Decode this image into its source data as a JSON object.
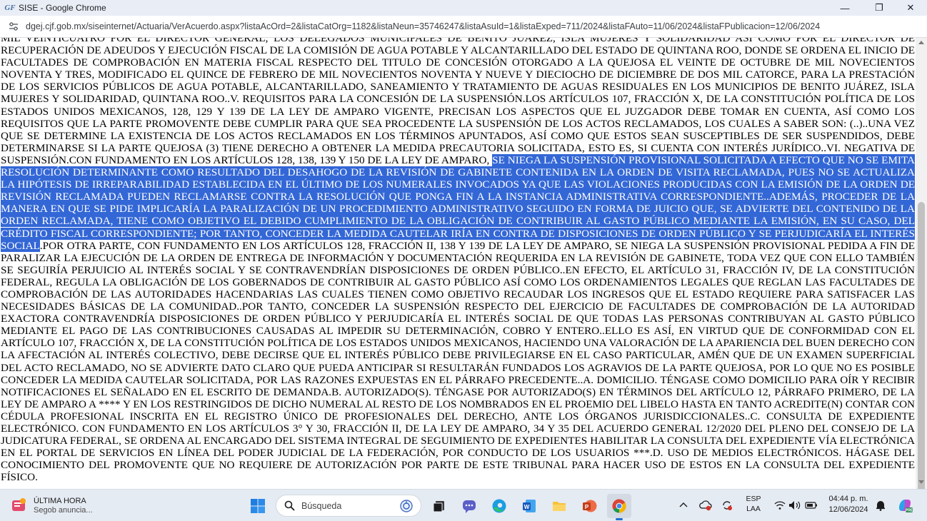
{
  "window": {
    "app_icon_glyph": "GF",
    "title": "SISE - Google Chrome",
    "minimize_glyph": "—",
    "maximize_glyph": "❐",
    "close_glyph": "✕"
  },
  "address_bar": {
    "url": "dgej.cjf.gob.mx/siseinternet/Actuaria/VerAcuerdo.aspx?listaAcOrd=2&listaCatOrg=1182&listaNeun=35746247&listaAsuId=1&listaExped=711/2024&listaFAuto=11/06/2024&listaFPublicacion=12/06/2024"
  },
  "document": {
    "text_before_selection": "MIL VEINTICUATRO POR EL DIRECTOR GENERAL, LOS DELEGADOS MUNICIPALES DE BENITO JUÁREZ, ISLA MUJERES Y SOLIDARIDAD ASÍ COMO POR EL DIRECTOR DE RECUPERACIÓN DE ADEUDOS Y EJECUCIÓN FISCAL DE LA COMISIÓN DE AGUA POTABLE Y ALCANTARILLADO DEL ESTADO DE QUINTANA ROO, DONDE SE ORDENA EL INICIO DE FACULTADES DE COMPROBACIÓN EN MATERIA FISCAL RESPECTO DEL TITULO DE CONCESIÓN OTORGADO A LA QUEJOSA EL VEINTE DE OCTUBRE DE MIL NOVECIENTOS NOVENTA Y TRES, MODIFICADO EL QUINCE DE FEBRERO DE MIL NOVECIENTOS NOVENTA Y NUEVE Y DIECIOCHO DE DICIEMBRE DE DOS MIL CATORCE, PARA LA PRESTACIÓN DE LOS SERVICIOS PÚBLICOS DE AGUA POTABLE, ALCANTARILLADO, SANEAMIENTO Y TRATAMIENTO DE AGUAS RESIDUALES EN LOS MUNICIPIOS DE BENITO JUÁREZ, ISLA MUJERES Y SOLIDARIDAD, QUINTANA ROO..V. REQUISITOS PARA LA CONCESIÓN DE LA SUSPENSIÓN.LOS ARTÍCULOS 107, FRACCIÓN X, DE LA CONSTITUCIÓN POLÍTICA DE LOS ESTADOS UNIDOS MEXICANOS, 128, 129 Y 139 DE LA LEY DE AMPARO VIGENTE, PRECISAN LOS ASPECTOS QUE EL JUZGADOR DEBE TOMAR EN CUENTA, ASÍ COMO LOS REQUISITOS QUE LA PARTE PROMOVENTE DEBE CUMPLIR PARA QUE SEA PROCEDENTE LA SUSPENSIÓN DE LOS ACTOS RECLAMADOS, LOS CUALES A SABER SON: (..)..UNA VEZ QUE SE DETERMINE LA EXISTENCIA DE LOS ACTOS RECLAMADOS EN LOS TÉRMINOS APUNTADOS, ASÍ COMO QUE ESTOS SEAN SUSCEPTIBLES DE SER SUSPENDIDOS, DEBE DETERMINARSE SI LA PARTE QUEJOSA (3) TIENE DERECHO A OBTENER LA MEDIDA PRECAUTORIA SOLICITADA, ESTO ES, SI CUENTA CON INTERÉS JURÍDICO..VI. NEGATIVA DE SUSPENSIÓN.CON FUNDAMENTO EN LOS ARTÍCULOS 128, 138, 139 Y 150 DE LA LEY DE AMPARO, ",
    "selected_text": "SE NIEGA LA SUSPENSIÓN PROVISIONAL SOLICITADA A EFECTO QUE NO SE EMITA RESOLUCIÓN DETERMINANTE COMO RESULTADO DEL DESAHOGO DE LA REVISIÓN DE GABINETE CONTENIDA EN LA ORDEN DE VISITA RECLAMADA, PUES NO SE ACTUALIZA LA HIPÓTESIS DE IRREPARABILIDAD ESTABLECIDA EN EL ÚLTIMO DE LOS NUMERALES INVOCADOS YA QUE LAS VIOLACIONES PRODUCIDAS CON LA EMISIÓN DE LA ORDEN DE REVISIÓN RECLAMADA PUEDEN RECLAMARSE CONTRA LA RESOLUCIÓN QUE PONGA FIN A LA INSTANCIA ADMINISTRATIVA CORRESPONDIENTE..ADEMÁS, PROCEDER DE LA MANERA EN QUE SE PIDE IMPLICARÍA LA PARALIZACIÓN DE UN PROCEDIMIENTO ADMINISTRATIVO SEGUIDO EN FORMA DE JUICIO QUE, SE ADVIERTE DEL CONTENIDO DE LA ORDEN RECLAMADA, TIENE COMO OBJETIVO EL DEBIDO CUMPLIMIENTO DE LA OBLIGACIÓN DE CONTRIBUIR AL GASTO PÚBLICO MEDIANTE LA EMISIÓN, EN SU CASO, DEL CRÉDITO FISCAL CORRESPONDIENTE; POR TANTO, CONCEDER LA MEDIDA CAUTELAR IRÍA EN CONTRA DE DISPOSICIONES DE ORDEN PÚBLICO Y SE PERJUDICARÍA EL INTERÉS SOCIAL",
    "text_after_selection": ".POR OTRA PARTE, CON FUNDAMENTO EN LOS ARTÍCULOS 128, FRACCIÓN II, 138 Y 139 DE LA LEY DE AMPARO, SE NIEGA LA SUSPENSIÓN PROVISIONAL PEDIDA A FIN DE PARALIZAR LA EJECUCIÓN DE LA ORDEN DE ENTREGA DE INFORMACIÓN Y DOCUMENTACIÓN REQUERIDA EN LA REVISIÓN DE GABINETE, TODA VEZ QUE CON ELLO TAMBIÉN SE SEGUIRÍA PERJUICIO AL INTERÉS SOCIAL Y SE CONTRAVENDRÍAN DISPOSICIONES DE ORDEN PÚBLICO..EN EFECTO, EL ARTÍCULO 31, FRACCIÓN IV, DE LA CONSTITUCIÓN FEDERAL, REGULA LA OBLIGACIÓN DE LOS GOBERNADOS DE CONTRIBUIR AL GASTO PÚBLICO ASÍ COMO LOS ORDENAMIENTOS LEGALES QUE REGLAN LAS FACULTADES DE COMPROBACIÓN DE LAS AUTORIDADES HACENDARIAS LAS CUALES TIENEN COMO OBJETIVO RECAUDAR LOS INGRESOS QUE EL ESTADO REQUIERE PARA SATISFACER LAS NECESIDADES BÁSICAS DE LA COMUNIDAD..POR TANTO, CONCEDER LA SUSPENSIÓN RESPECTO DEL EJERCICIO DE FACULTADES DE COMPROBACIÓN DE LA AUTORIDAD EXACTORA CONTRAVENDRÍA DISPOSICIONES DE ORDEN PÚBLICO Y PERJUDICARÍA EL INTERÉS SOCIAL DE QUE TODAS LAS PERSONAS CONTRIBUYAN AL GASTO PÚBLICO MEDIANTE EL PAGO DE LAS CONTRIBUCIONES CAUSADAS AL IMPEDIR SU DETERMINACIÓN, COBRO Y ENTERO..ELLO ES ASÍ, EN VIRTUD QUE DE CONFORMIDAD CON EL ARTÍCULO 107, FRACCIÓN X, DE LA CONSTITUCIÓN POLÍTICA DE LOS ESTADOS UNIDOS MEXICANOS, HACIENDO UNA VALORACIÓN DE LA APARIENCIA DEL BUEN DERECHO CON LA AFECTACIÓN AL INTERÉS COLECTIVO, DEBE DECIRSE QUE EL INTERÉS PÚBLICO DEBE PRIVILEGIARSE EN EL CASO PARTICULAR, AMÉN QUE DE UN EXAMEN SUPERFICIAL DEL ACTO RECLAMADO, NO SE ADVIERTE DATO CLARO QUE PUEDA ANTICIPAR SI RESULTARÁN FUNDADOS LOS AGRAVIOS DE LA PARTE QUEJOSA, POR LO QUE NO ES POSIBLE CONCEDER LA MEDIDA CAUTELAR SOLICITADA, POR LAS RAZONES EXPUESTAS EN EL PÁRRAFO PRECEDENTE..A. DOMICILIO. TÉNGASE COMO DOMICILIO PARA OÍR Y RECIBIR NOTIFICACIONES EL SEÑALADO EN EL ESCRITO DE DEMANDA.B. AUTORIZADO(S). TÉNGASE POR AUTORIZADO(S) EN TÉRMINOS DEL ARTÍCULO 12, PÁRRAFO PRIMERO, DE LA LEY DE AMPARO A **** Y EN LOS RESTRINGIDOS DE DICHO NUMERAL AL RESTO DE LOS NOMBRADOS EN EL PROEMIO DEL LIBELO HASTA EN TANTO ACREDITE(N) CONTAR CON CÉDULA PROFESIONAL INSCRITA EN EL REGISTRO ÚNICO DE PROFESIONALES DEL DERECHO, ANTE LOS ÓRGANOS JURISDICCIONALES..C. CONSULTA DE EXPEDIENTE ELECTRÓNICO. CON FUNDAMENTO EN LOS ARTÍCULOS 3° Y 30, FRACCIÓN II, DE LA LEY DE AMPARO, 34 Y 35 DEL ACUERDO GENERAL 12/2020 DEL PLENO DEL CONSEJO DE LA JUDICATURA FEDERAL, SE ORDENA AL ENCARGADO DEL SISTEMA INTEGRAL DE SEGUIMIENTO DE EXPEDIENTES HABILITAR LA CONSULTA DEL EXPEDIENTE VÍA ELECTRÓNICA EN EL PORTAL DE SERVICIOS EN LÍNEA DEL PODER JUDICIAL DE LA FEDERACIÓN, POR CONDUCTO DE LOS USUARIOS ***.D. USO DE MEDIOS ELECTRÓNICOS. HÁGASE DEL CONOCIMIENTO DEL PROMOVENTE QUE NO REQUIERE DE AUTORIZACIÓN POR PARTE DE ESTE TRIBUNAL PARA HACER USO DE ESTOS EN LA CONSULTA DEL EXPEDIENTE FÍSICO."
  },
  "taskbar": {
    "news_title": "ÚLTIMA HORA",
    "news_subtitle": "Segob anuncia...",
    "search_placeholder": "Búsqueda",
    "apps": [
      "start-icon",
      "task-view-icon",
      "chat-icon",
      "edge-icon",
      "word-icon",
      "file-explorer-icon",
      "powerpoint-icon",
      "chrome-icon"
    ],
    "active_app": "chrome-icon",
    "tray_chevron_glyph": "^",
    "language": "ESP",
    "language_sub": "LAA",
    "time": "04:44 p. m.",
    "date": "12/06/2024"
  },
  "colors": {
    "selection_bg": "#3367d6",
    "titlebar_bg": "#e9eef6",
    "taskbar_bg": "#e5ebf3"
  }
}
